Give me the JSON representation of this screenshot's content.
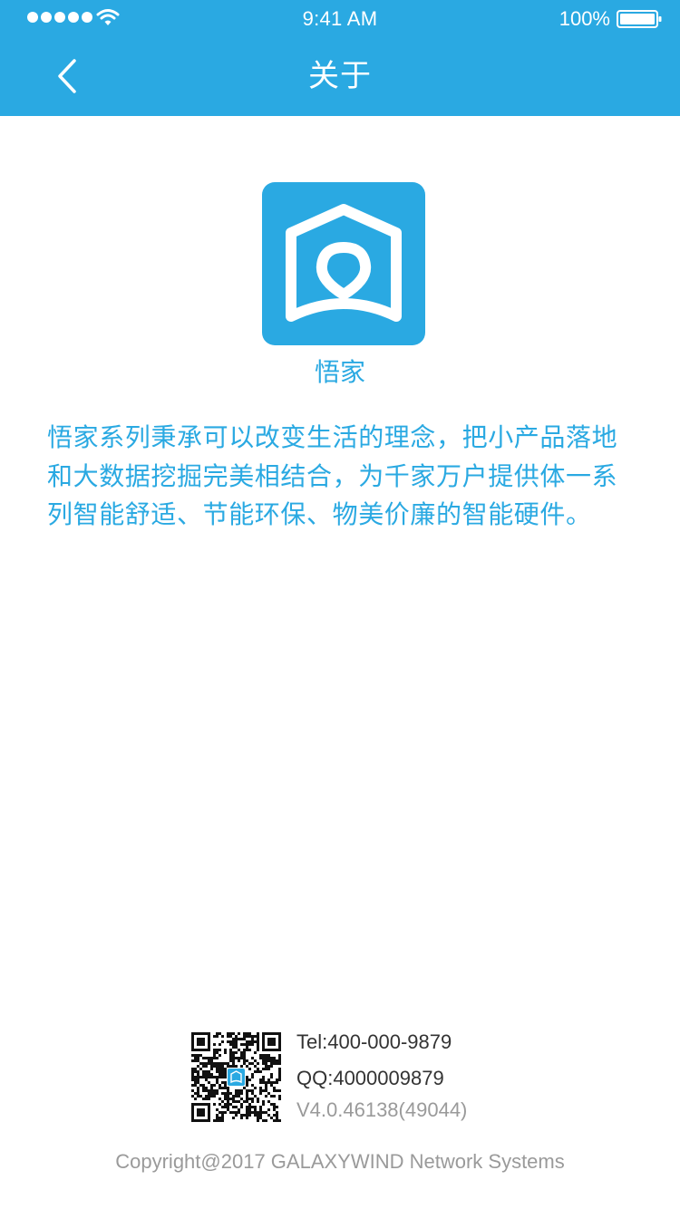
{
  "status_bar": {
    "time": "9:41 AM",
    "battery": "100%",
    "signal_icon": "signal-dots-icon",
    "wifi_icon": "wifi-icon",
    "battery_icon": "battery-icon"
  },
  "nav": {
    "title": "关于",
    "back_icon": "chevron-left-icon"
  },
  "app": {
    "name": "悟家",
    "logo_icon": "house-logo-icon",
    "description": "悟家系列秉承可以改变生活的理念，把小产品落地和大数据挖掘完美相结合，为千家万户提供体一系列智能舒适、节能环保、物美价廉的智能硬件。"
  },
  "contact": {
    "tel": "Tel:400-000-9879",
    "qq": "QQ:4000009879",
    "version": "V4.0.46138(49044)",
    "qr_icon": "qr-code-icon"
  },
  "footer": {
    "copyright": "Copyright@2017 GALAXYWIND Network Systems"
  },
  "colors": {
    "accent": "#2aa9e2",
    "text_dark": "#333333",
    "text_muted": "#9a9a9a",
    "background": "#ffffff"
  }
}
